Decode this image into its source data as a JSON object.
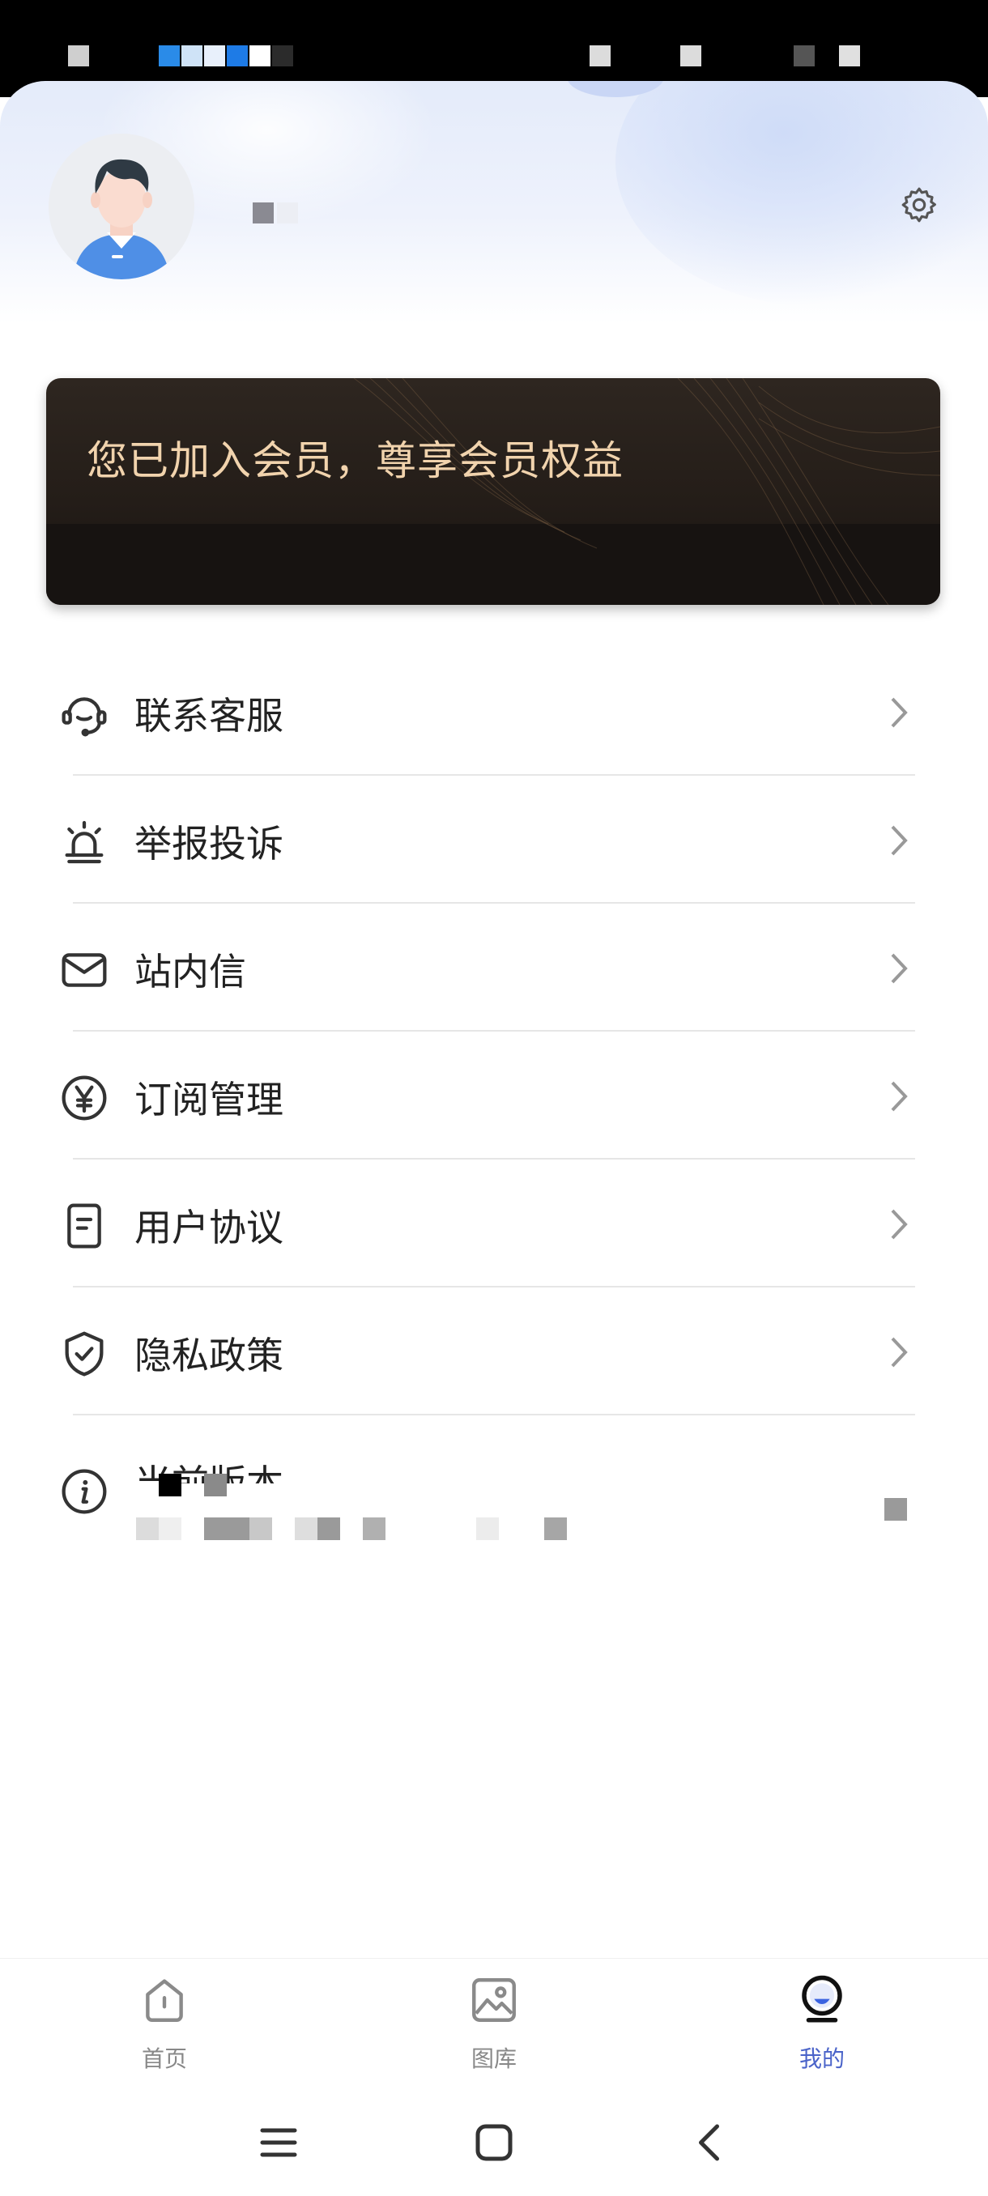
{
  "header": {
    "username": ""
  },
  "member_card": {
    "text": "您已加入会员，尊享会员权益"
  },
  "menu": {
    "items": [
      {
        "label": "联系客服",
        "icon": "headset-icon"
      },
      {
        "label": "举报投诉",
        "icon": "alarm-icon"
      },
      {
        "label": "站内信",
        "icon": "mail-icon"
      },
      {
        "label": "订阅管理",
        "icon": "yen-circle-icon"
      },
      {
        "label": "用户协议",
        "icon": "document-icon"
      },
      {
        "label": "隐私政策",
        "icon": "shield-check-icon"
      }
    ],
    "version": {
      "label": "当前版本",
      "icon": "info-icon"
    }
  },
  "tabbar": {
    "tabs": [
      {
        "label": "首页",
        "icon": "home-icon"
      },
      {
        "label": "图库",
        "icon": "gallery-icon"
      },
      {
        "label": "我的",
        "icon": "profile-icon"
      }
    ],
    "active_color": "#4a63c9"
  },
  "colors": {
    "member_text": "#f1d3ad",
    "card_bg": "#241d18"
  }
}
